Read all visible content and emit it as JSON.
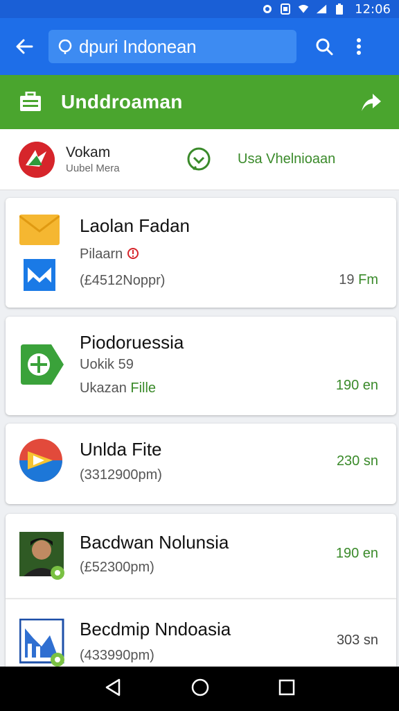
{
  "status_bar": {
    "time": "12:06"
  },
  "app_bar": {
    "search_value": "dpuri Indonean"
  },
  "header": {
    "title": "Unddroaman"
  },
  "account": {
    "name": "Vokam",
    "subtitle": "Uubel Mera",
    "link_label": "Usa Vhelnioaan"
  },
  "cards": [
    {
      "title": "Laolan Fadan",
      "line2": "Pilaarn",
      "line3": "(£4512Noppr)",
      "amount": "19",
      "amount_suffix": "Fm"
    },
    {
      "title": "Piodoruessia",
      "line2": "Uokik 59",
      "line3_a": "Ukazan",
      "line3_b": "Fille",
      "amount": "190 en"
    },
    {
      "title": "Unlda Fite",
      "line3": "(3312900pm)",
      "amount": "230 sn"
    },
    {
      "title": "Bacdwan Nolunsia",
      "line3": "(£52300pm)",
      "amount": "190 en"
    },
    {
      "title": "Becdmip Nndoasia",
      "line3": "(433990pm)",
      "amount": "303 sn"
    }
  ],
  "colors": {
    "blue": "#1e6ee8",
    "green": "#4aa52e",
    "accent_green": "#3a8a2a"
  }
}
